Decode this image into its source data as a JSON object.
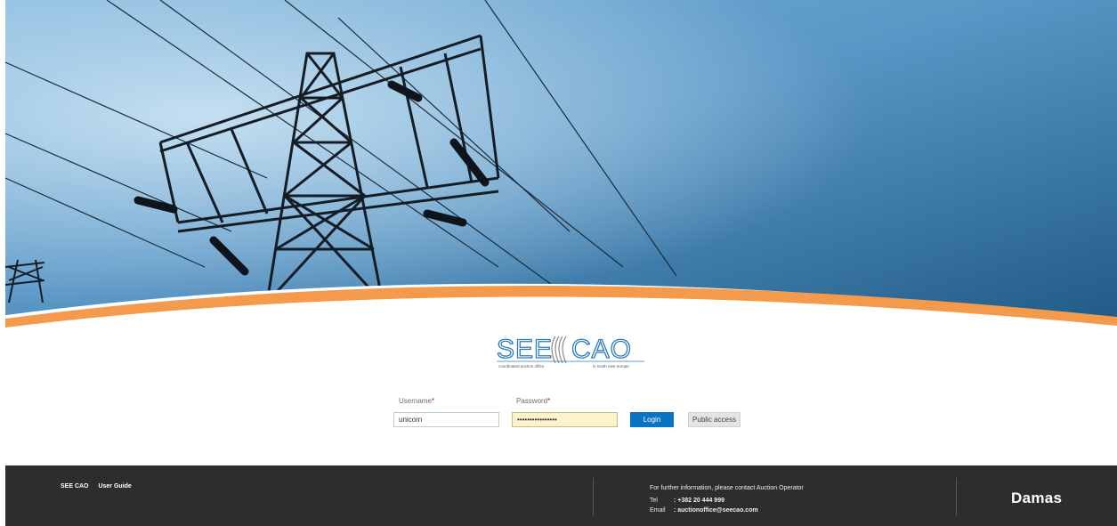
{
  "logo": {
    "name": "SEE CAO",
    "left_text": "SEE",
    "right_text": "CAO",
    "tagline_left": "coordinated auction office",
    "tagline_right": "in south east europe"
  },
  "login_form": {
    "username": {
      "label": "Username",
      "required_marker": "*",
      "value": "unicorn"
    },
    "password": {
      "label": "Password",
      "required_marker": "*",
      "value": "••••••••••••••••"
    },
    "login_button": "Login",
    "public_access_button": "Public access"
  },
  "footer": {
    "links": [
      "SEE CAO",
      "User Guide"
    ],
    "contact_heading": "For further information, please contact Auction Operator",
    "tel_label": "Tel",
    "tel_value": ": +382 20 444 999",
    "email_label": "Email",
    "email_value": ": auctionoffice@seecao.com",
    "brand": "Damas"
  },
  "colors": {
    "accent_orange": "#f39a4c",
    "login_blue": "#0a73c4",
    "footer_bg": "#2e2d2c",
    "logo_blue": "#2b7bbf"
  }
}
